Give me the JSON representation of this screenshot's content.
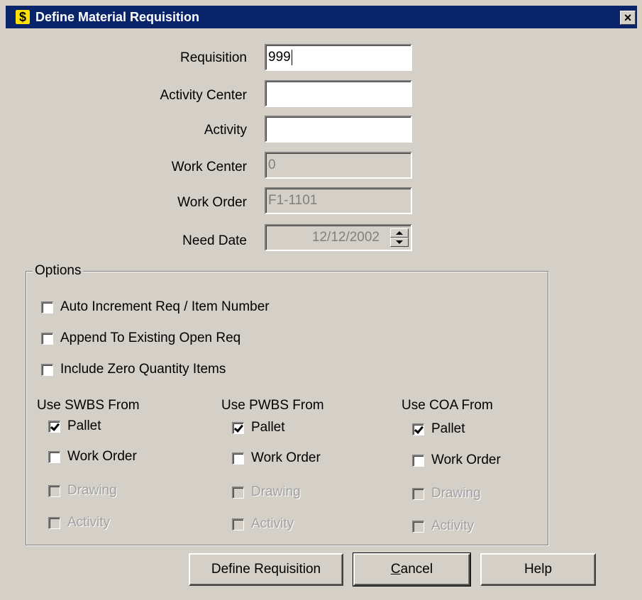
{
  "window": {
    "title": "Define Material Requisition",
    "icon": "dollar-icon",
    "icon_glyph": "$",
    "close_glyph": "×"
  },
  "form": {
    "requisition": {
      "label": "Requisition",
      "value": "999"
    },
    "activity_center": {
      "label": "Activity Center",
      "value": ""
    },
    "activity": {
      "label": "Activity",
      "value": ""
    },
    "work_center": {
      "label": "Work Center",
      "value": "0"
    },
    "work_order": {
      "label": "Work Order",
      "value": "F1-1101"
    },
    "need_date": {
      "label": "Need Date",
      "value": "12/12/2002"
    }
  },
  "options": {
    "legend": "Options",
    "auto_increment": {
      "label": "Auto Increment Req / Item Number",
      "checked": false
    },
    "append_existing": {
      "label": "Append To Existing Open Req",
      "checked": false
    },
    "include_zero": {
      "label": "Include Zero Quantity Items",
      "checked": false
    },
    "swbs": {
      "header": "Use SWBS From",
      "items": [
        {
          "label": "Pallet",
          "checked": true,
          "enabled": true
        },
        {
          "label": "Work Order",
          "checked": false,
          "enabled": true
        },
        {
          "label": "Drawing",
          "checked": false,
          "enabled": false
        },
        {
          "label": "Activity",
          "checked": false,
          "enabled": false
        }
      ]
    },
    "pwbs": {
      "header": "Use PWBS From",
      "items": [
        {
          "label": "Pallet",
          "checked": true,
          "enabled": true
        },
        {
          "label": "Work Order",
          "checked": false,
          "enabled": true
        },
        {
          "label": "Drawing",
          "checked": false,
          "enabled": false
        },
        {
          "label": "Activity",
          "checked": false,
          "enabled": false
        }
      ]
    },
    "coa": {
      "header": "Use COA From",
      "items": [
        {
          "label": "Pallet",
          "checked": true,
          "enabled": true
        },
        {
          "label": "Work Order",
          "checked": false,
          "enabled": true
        },
        {
          "label": "Drawing",
          "checked": false,
          "enabled": false
        },
        {
          "label": "Activity",
          "checked": false,
          "enabled": false
        }
      ]
    }
  },
  "buttons": {
    "define": "Define Requisition",
    "cancel_mnemonic": "C",
    "cancel_rest": "ancel",
    "help": "Help"
  },
  "colors": {
    "titlebar": "#0a246a",
    "face": "#d4d0c8",
    "disabled_text": "#808080"
  }
}
